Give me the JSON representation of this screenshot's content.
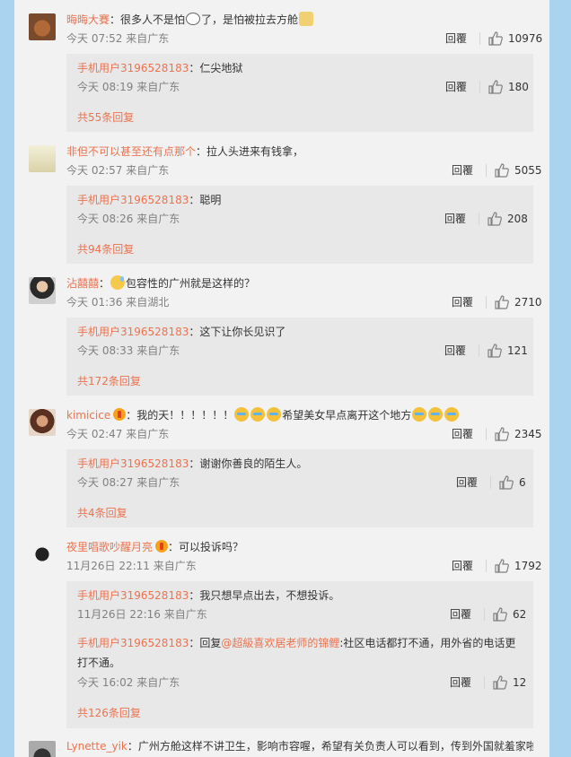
{
  "comments": [
    {
      "user": "晦晦大賽",
      "text_before_emoji1": "：很多人不是怕",
      "emoji1": "bubble-emoji",
      "text_mid": "了，是怕被拉去方舱",
      "emoji2": "dog-emoji",
      "time": "今天 07:52",
      "from": "来自广东",
      "reply_label": "回覆",
      "likes": "10976",
      "replies": [
        {
          "user": "手机用户3196528183",
          "text": "：仁尖地狱",
          "time": "今天 08:19",
          "from": "来自广东",
          "reply_label": "回覆",
          "likes": "180"
        }
      ],
      "more": "共55条回复"
    },
    {
      "user": "非但不可以甚至还有点那个",
      "text": "：拉人头进来有钱拿，",
      "time": "今天 02:57",
      "from": "来自广东",
      "reply_label": "回覆",
      "likes": "5055",
      "replies": [
        {
          "user": "手机用户3196528183",
          "text": "：聪明",
          "time": "今天 08:26",
          "from": "来自广东",
          "reply_label": "回覆",
          "likes": "208"
        }
      ],
      "more": "共94条回复"
    },
    {
      "user": "沾囍囍",
      "text_prefix": "：",
      "emoji": "sweat-emoji",
      "text": "包容性的广州就是这样的？",
      "time": "今天 01:36",
      "from": "来自湖北",
      "reply_label": "回覆",
      "likes": "2710",
      "replies": [
        {
          "user": "手机用户3196528183",
          "text": "：这下让你长见识了",
          "time": "今天 08:33",
          "from": "来自广东",
          "reply_label": "回覆",
          "likes": "121"
        }
      ],
      "more": "共172条回复"
    },
    {
      "user": "kimicice",
      "badge": "vip-badge",
      "text_before": "：我的天！！！！！！",
      "emojis_a": [
        "cry-emoji",
        "cry-emoji",
        "cry-emoji"
      ],
      "text_mid": "希望美女早点离开这个地方",
      "emojis_b": [
        "cry-emoji",
        "cry-emoji",
        "cry-emoji"
      ],
      "time": "今天 02:47",
      "from": "来自广东",
      "reply_label": "回覆",
      "likes": "2345",
      "replies": [
        {
          "user": "手机用户3196528183",
          "text": "：谢谢你善良的陌生人。",
          "time": "今天 08:27",
          "from": "来自广东",
          "reply_label": "回覆",
          "likes": "6"
        }
      ],
      "more": "共4条回复"
    },
    {
      "user": "夜里唱歌吵醒月亮",
      "badge": "vip-badge",
      "text": "：可以投诉吗？",
      "time": "11月26日 22:11",
      "from": "来自广东",
      "reply_label": "回覆",
      "likes": "1792",
      "replies": [
        {
          "user": "手机用户3196528183",
          "text": "：我只想早点出去，不想投诉。",
          "time": "11月26日 22:16",
          "from": "来自广东",
          "reply_label": "回覆",
          "likes": "62"
        },
        {
          "user": "手机用户3196528183",
          "text_a": "：回复",
          "mention": "@超級喜欢居老师的锦鲤",
          "text_b": ":社区电话都打不通，用外省的电话更打不通。",
          "time": "今天 16:02",
          "from": "来自广东",
          "reply_label": "回覆",
          "likes": "12"
        }
      ],
      "more": "共126条回复"
    },
    {
      "user": "Lynette_yik",
      "text": "：广州方舱这样不讲卫生，影响市容喔，希望有关负责人可以看到，传到外国就羞家啦"
    }
  ],
  "colors": {
    "accent": "#eb7350",
    "background": "#a9d3ef",
    "panel": "#f2f2f2",
    "reply_box": "#e8e8e8"
  }
}
